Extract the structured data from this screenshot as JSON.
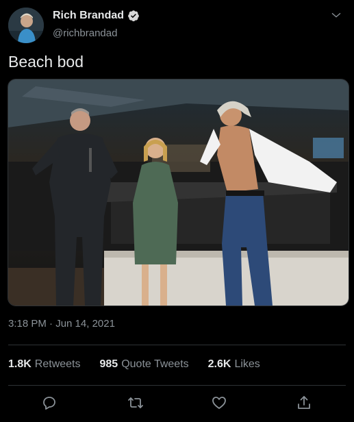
{
  "author": {
    "display_name": "Rich Brandad",
    "handle": "@richbrandad",
    "verified": true
  },
  "tweet": {
    "text": "Beach bod",
    "timestamp": "3:18 PM · Jun 14, 2021"
  },
  "stats": {
    "retweets_count": "1.8K",
    "retweets_label": "Retweets",
    "quotes_count": "985",
    "quotes_label": "Quote Tweets",
    "likes_count": "2.6K",
    "likes_label": "Likes"
  },
  "actions": {
    "reply_icon": "reply-icon",
    "retweet_icon": "retweet-icon",
    "like_icon": "heart-icon",
    "share_icon": "share-icon"
  },
  "colors": {
    "background": "#000000",
    "text": "#e7e9ea",
    "secondary": "#8b9298",
    "divider": "#2f3336"
  }
}
